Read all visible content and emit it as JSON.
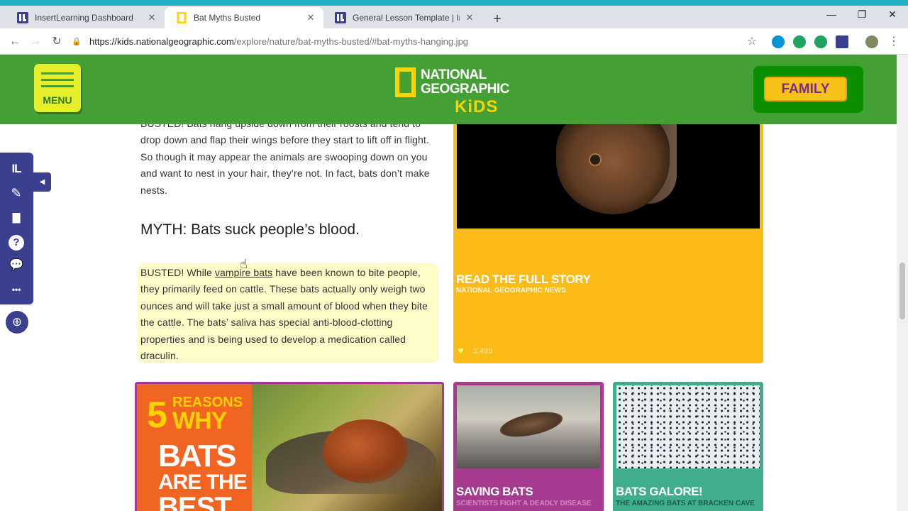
{
  "browser": {
    "tabs": [
      {
        "title": "InsertLearning Dashboard",
        "active": false
      },
      {
        "title": "Bat Myths Busted",
        "active": true
      },
      {
        "title": "General Lesson Template | InsertL",
        "active": false
      }
    ],
    "close_glyph": "✕",
    "new_tab_glyph": "+",
    "window_controls": {
      "minimize": "—",
      "maximize": "❐",
      "close": "✕"
    },
    "nav": {
      "back": "←",
      "forward": "→",
      "reload": "↻"
    },
    "url_host": "https://kids.nationalgeographic.com",
    "url_path": "/explore/nature/bat-myths-busted/#bat-myths-hanging.jpg",
    "bookmark_star": "☆",
    "menu_dots": "⋮"
  },
  "site": {
    "menu_label": "MENU",
    "logo": {
      "line1": "NATIONAL",
      "line2": "GEOGRAPHIC",
      "line3": "KiDS"
    },
    "family_label": "FAMILY",
    "colors": {
      "header_green": "#44a035",
      "menu_yellow": "#e7ef2a",
      "family_yellow": "#f7c117",
      "card_yellow": "#fbbc17",
      "card_purple": "#a53a8f",
      "card_green": "#3fae8d"
    }
  },
  "article": {
    "para1": "BUSTED! Bats hang upside down from their roosts and tend to drop down and flap their wings before they start to lift off in flight. So though it may appear the animals are swooping down on you and want to nest in your hair, they’re not. In fact, bats don’t make nests.",
    "myth_heading": "MYTH: Bats suck people’s blood.",
    "para2_before": "BUSTED! While ",
    "para2_link": "vampire bats",
    "para2_after": " have been known to bite people, they primarily feed on cattle. These bats actually only weigh two ounces and will take just a small amount of blood when they bite the cattle. The bats’ saliva has special anti-blood-clotting properties and is being used to develop a medication called draculin."
  },
  "cards": {
    "main": {
      "title": "READ THE FULL STORY",
      "subtitle": "NATIONAL GEOGRAPHIC NEWS",
      "likes": "3,499",
      "heart": "♥"
    },
    "promo": {
      "number": "5",
      "line1": "REASONS",
      "line2": "WHY",
      "line3": "BATS",
      "line4": "ARE THE",
      "line5": "BEST"
    },
    "saving": {
      "title": "SAVING BATS",
      "subtitle": "SCIENTISTS FIGHT A DEADLY DISEASE"
    },
    "galore": {
      "title": "BATS GALORE!",
      "subtitle": "THE AMAZING BATS AT BRACKEN CAVE"
    }
  },
  "insertlearning": {
    "logo": "IL",
    "tools": [
      "pencil-icon",
      "sticky-note-icon",
      "question-icon",
      "discussion-icon",
      "more-icon"
    ],
    "tool_glyphs": {
      "pencil": "✎",
      "note": "▇",
      "question": "?",
      "discussion": "💬",
      "more": "•••"
    },
    "collapse_glyph": "◀",
    "help_glyph": "⊕"
  }
}
